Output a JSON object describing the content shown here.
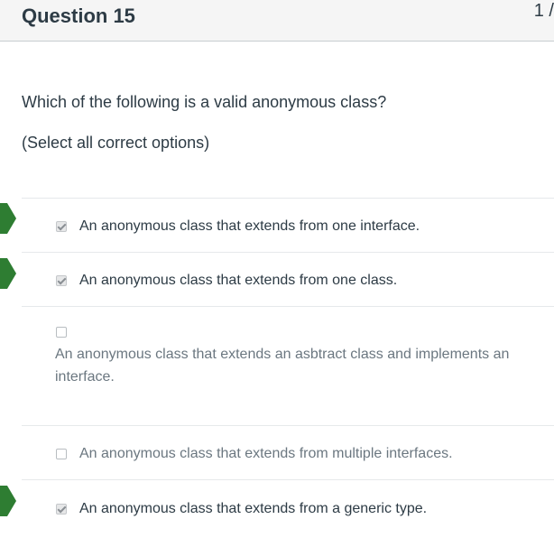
{
  "header": {
    "title": "Question 15",
    "points": "1 /"
  },
  "question": {
    "text": "Which of the following is a valid anonymous class?",
    "instruction": "(Select all correct options)"
  },
  "answers": [
    {
      "label": "An anonymous class that extends from one interface.",
      "selected": true,
      "marked_correct": true
    },
    {
      "label": "An anonymous class that extends from one class.",
      "selected": true,
      "marked_correct": true
    },
    {
      "label": "An anonymous class that extends an asbtract class and implements an interface.",
      "selected": false,
      "marked_correct": false
    },
    {
      "label": "An anonymous class that extends from multiple interfaces.",
      "selected": false,
      "marked_correct": false
    },
    {
      "label": "An anonymous class that extends from a generic type.",
      "selected": true,
      "marked_correct": true
    }
  ],
  "colors": {
    "correct_marker": "#2e7d32",
    "header_bg": "#f5f5f5",
    "text": "#2d3b45",
    "unselected_text": "#6b7780"
  },
  "icons": {
    "correct_marker": "correct-answer-arrow-icon",
    "checkbox_checked": "checkbox-checked-icon",
    "checkbox_empty": "checkbox-empty-icon"
  }
}
